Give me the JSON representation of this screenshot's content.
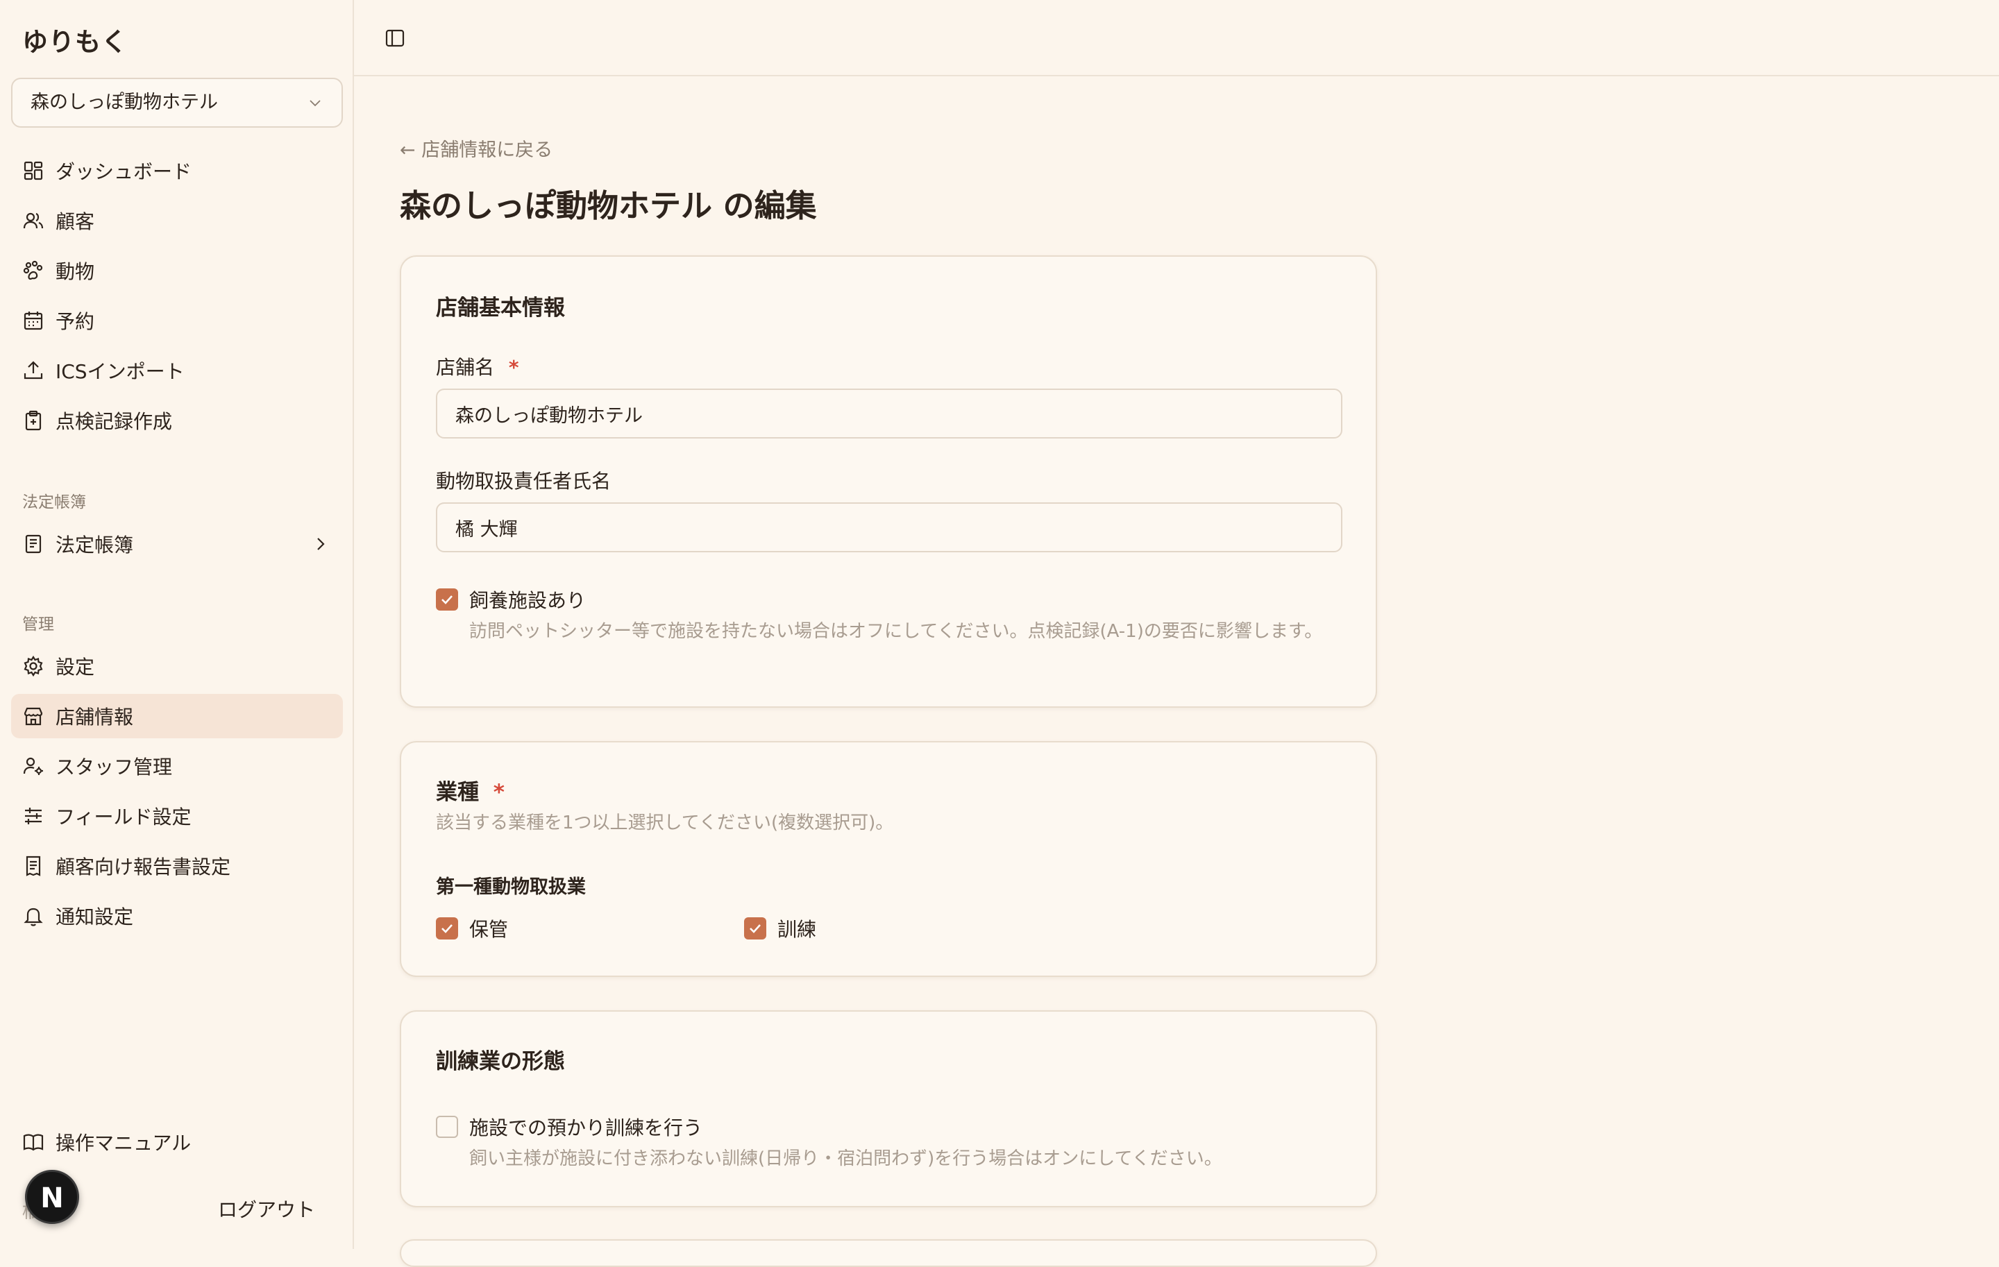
{
  "app": {
    "title": "ゆりもく"
  },
  "store_selector": {
    "value": "森のしっぽ動物ホテル"
  },
  "nav": {
    "items": [
      {
        "label": "ダッシュボード"
      },
      {
        "label": "顧客"
      },
      {
        "label": "動物"
      },
      {
        "label": "予約"
      },
      {
        "label": "ICSインポート"
      },
      {
        "label": "点検記録作成"
      }
    ],
    "legal_section": "法定帳簿",
    "legal_item": "法定帳簿",
    "admin_section": "管理",
    "admin_items": [
      {
        "label": "設定"
      },
      {
        "label": "店舗情報"
      },
      {
        "label": "スタッフ管理"
      },
      {
        "label": "フィールド設定"
      },
      {
        "label": "顧客向け報告書設定"
      },
      {
        "label": "通知設定"
      }
    ],
    "manual": "操作マニュアル"
  },
  "user": {
    "avatar_letter": "N",
    "name": "橘 輝",
    "logout": "ログアウト"
  },
  "page": {
    "back": "← 店舗情報に戻る",
    "title": "森のしっぽ動物ホテル の編集"
  },
  "basic": {
    "title": "店舗基本情報",
    "name_label": "店舗名",
    "required_mark": "*",
    "name_value": "森のしっぽ動物ホテル",
    "manager_label": "動物取扱責任者氏名",
    "manager_value": "橘 大輝",
    "facility_label": "飼養施設あり",
    "facility_checked": true,
    "facility_help": "訪問ペットシッター等で施設を持たない場合はオフにしてください。点検記録(A-1)の要否に影響します。"
  },
  "business": {
    "title": "業種",
    "required_mark": "*",
    "help": "該当する業種を1つ以上選択してください(複数選択可)。",
    "group_title": "第一種動物取扱業",
    "options": [
      {
        "label": "保管",
        "checked": true
      },
      {
        "label": "訓練",
        "checked": true
      }
    ]
  },
  "training": {
    "title": "訓練業の形態",
    "option_label": "施設での預かり訓練を行う",
    "option_checked": false,
    "help": "飼い主様が施設に付き添わない訓練(日帰り・宿泊問わず)を行う場合はオンにしてください。"
  },
  "colors": {
    "accent": "#c8714b",
    "background": "#fcf5ec",
    "active_nav": "#f6e4d6",
    "required": "#d64a3a"
  }
}
